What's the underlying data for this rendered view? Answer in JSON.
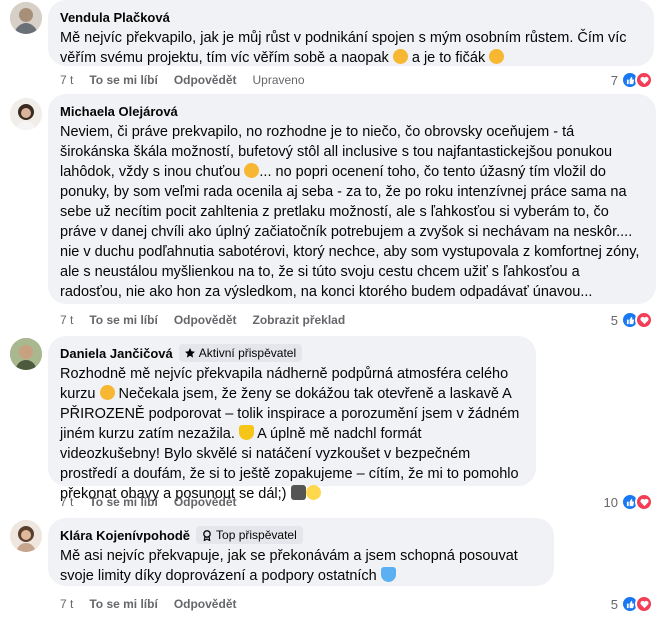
{
  "comments": [
    {
      "author": "Vendula Plačková",
      "badge": "",
      "text_parts": [
        "Mě nejvíc překvapilo, jak je můj růst v podnikání spojen s mým osobním růstem. Čím víc věřím svému projektu, tím víc věřím sobě a naopak ",
        " a je to fičák "
      ],
      "time": "7 t",
      "like_label": "To se mi líbí",
      "reply_label": "Odpovědět",
      "extra_label": "Upraveno",
      "reaction_count": "7"
    },
    {
      "author": "Michaela Olejárová",
      "badge": "",
      "text_parts": [
        "Neviem, či práve prekvapilo, no rozhodne je to niečo, čo obrovsky oceňujem - tá širokánska škála možností, bufetový stôl all inclusive s tou najfantastickejšou ponukou lahôdok, vždy s inou chuťou ",
        "... no popri ocenení toho, čo tento úžasný tím vložil do ponuky, by som veľmi rada ocenila aj seba - za to, že po roku intenzívnej práce sama na sebe už necítim pocit zahltenia z pretlaku možností, ale s ľahkosťou si vyberám to, čo práve v danej chvíli ako úplný začiatočník potrebujem a zvyšok si nechávam na neskôr.... nie v duchu podľahnutia sabotérovi, ktorý nechce, aby som vystupovala z komfortnej zóny, ale s neustálou myšlienkou na to, že si túto svoju cestu chcem užiť s ľahkosťou a radosťou, nie ako hon za výsledkom, na konci ktorého budem odpadávať únavou..."
      ],
      "time": "7 t",
      "like_label": "To se mi líbí",
      "reply_label": "Odpovědět",
      "extra_label": "Zobrazit překlad",
      "reaction_count": "5"
    },
    {
      "author": "Daniela Jančičová",
      "badge": "Aktivní přispěvatel",
      "text_parts": [
        "Rozhodně mě nejvíc překvapila nádherně podpůrná atmosféra celého kurzu ",
        " Nečekala jsem, že ženy se dokážou tak otevřeně a laskavě A PŘIROZENĚ podporovat – tolik inspirace a porozumění jsem v žádném jiném kurzu zatím nezažila. ",
        " A úplně mě nadchl formát videozkušebny! Bylo skvělé si natáčení vyzkoušet v bezpečném prostředí a doufám, že si to ještě zopakujeme – cítím, že mi to pomohlo překonat obavy a posunout se dál;) "
      ],
      "time": "7 t",
      "like_label": "To se mi líbí",
      "reply_label": "Odpovědět",
      "extra_label": "",
      "reaction_count": "10"
    },
    {
      "author": "Klára Kojenívpohodě",
      "badge": "Top přispěvatel",
      "text_parts": [
        "Mě asi nejvíc překvapuje, jak se překonávám a jsem schopná posouvat svoje limity díky doprovázení a podpory ostatních "
      ],
      "time": "7 t",
      "like_label": "To se mi líbí",
      "reply_label": "Odpovědět",
      "extra_label": "",
      "reaction_count": "5"
    }
  ],
  "colors": {
    "bubble": "#f0f2f5",
    "meta": "#65676b",
    "like": "#1877f2",
    "love": "#f33e58"
  }
}
